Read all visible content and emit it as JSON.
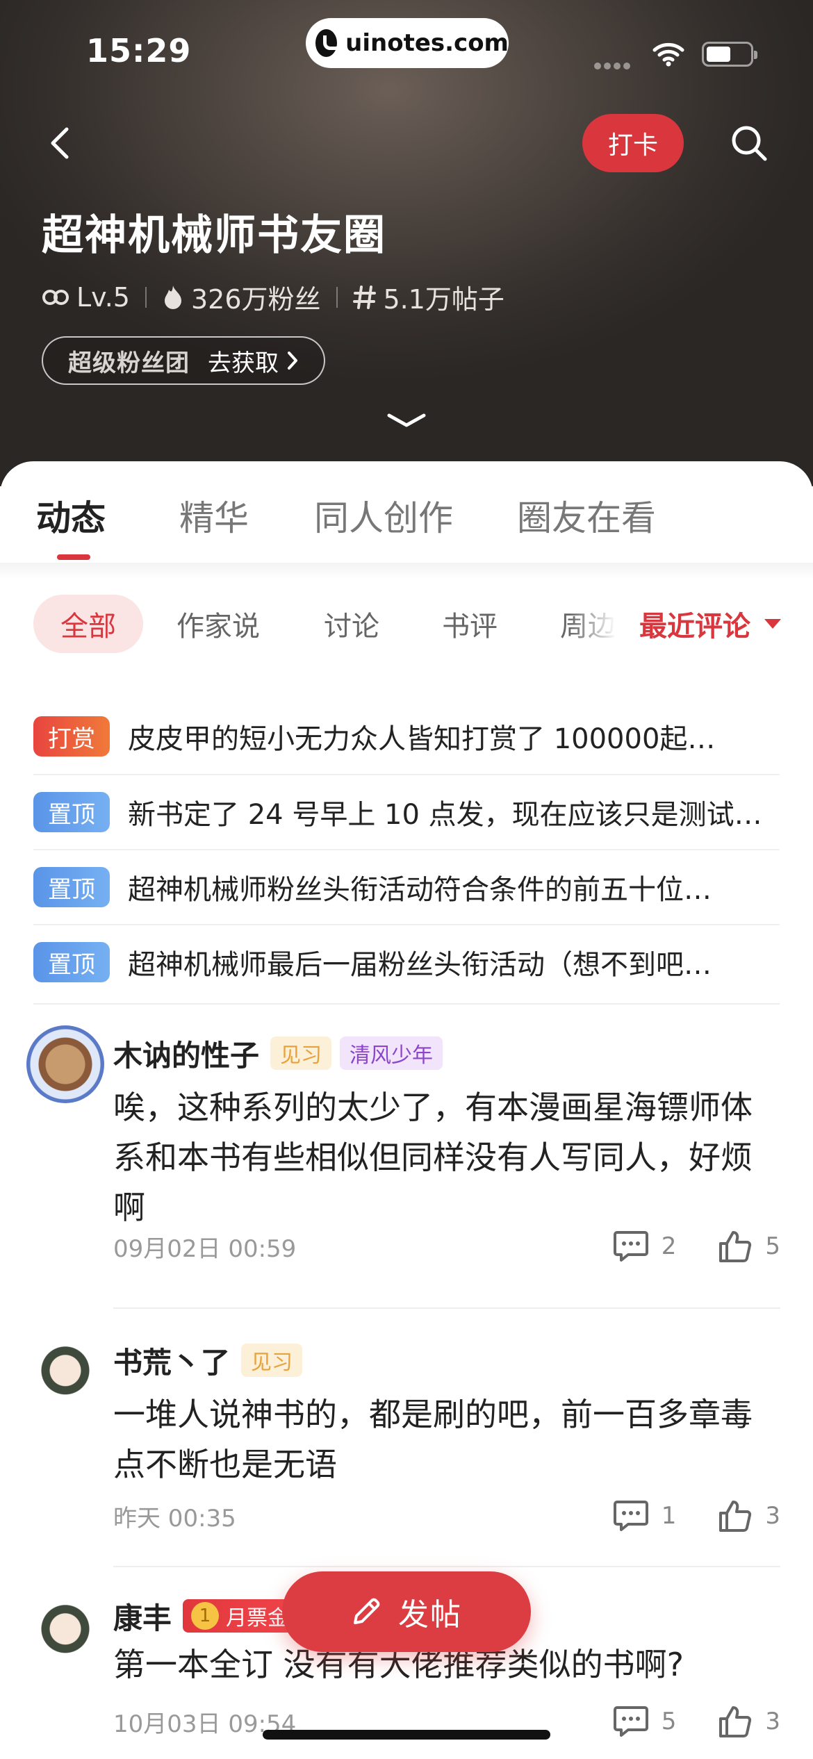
{
  "status_bar": {
    "time": "15:29",
    "url": "uinotes.com"
  },
  "header": {
    "checkin_label": "打卡",
    "title": "超神机械师书友圈",
    "level": "Lv.5",
    "fans": "326万粉丝",
    "posts": "5.1万帖子",
    "fan_club_label": "超级粉丝团",
    "fan_club_cta": "去获取"
  },
  "tabs": [
    {
      "label": "动态",
      "active": true
    },
    {
      "label": "精华",
      "active": false
    },
    {
      "label": "同人创作",
      "active": false
    },
    {
      "label": "圈友在看",
      "active": false
    }
  ],
  "filters": {
    "chips": [
      "全部",
      "作家说",
      "讨论",
      "书评",
      "周边"
    ],
    "active": "全部",
    "sort_label": "最近评论"
  },
  "pinned": [
    {
      "tag": "打赏",
      "type": "reward",
      "text": "皮皮甲的短小无力众人皆知打赏了 100000起…"
    },
    {
      "tag": "置顶",
      "type": "top",
      "text": "新书定了 24 号早上 10 点发，现在应该只是测试…"
    },
    {
      "tag": "置顶",
      "type": "top",
      "text": "超神机械师粉丝头衔活动符合条件的前五十位…"
    },
    {
      "tag": "置顶",
      "type": "top",
      "text": "超神机械师最后一届粉丝头衔活动（想不到吧…"
    }
  ],
  "posts": [
    {
      "username": "木讷的性子",
      "badges": [
        "见习",
        "清风少年"
      ],
      "content": "唉，这种系列的太少了，有本漫画星海镖师体系和本书有些相似但同样没有人写同人，好烦啊",
      "time": "09月02日 00:59",
      "comments": "2",
      "likes": "5"
    },
    {
      "username": "书荒丶了",
      "badges": [
        "见习"
      ],
      "content": "一堆人说神书的，都是刷的吧，前一百多章毒点不断也是无语",
      "time": "昨天 00:35",
      "comments": "1",
      "likes": "3"
    },
    {
      "username": "康丰",
      "badges": [
        "月票金"
      ],
      "content": "第一本全订 没有有大佬推荐类似的书啊?",
      "time": "10月03日 09:54",
      "comments": "5",
      "likes": "3"
    }
  ],
  "fab": {
    "label": "发帖"
  },
  "colors": {
    "accent": "#d9363e",
    "reward_tag": "#e8453f",
    "pin_tag": "#5a94e8"
  }
}
